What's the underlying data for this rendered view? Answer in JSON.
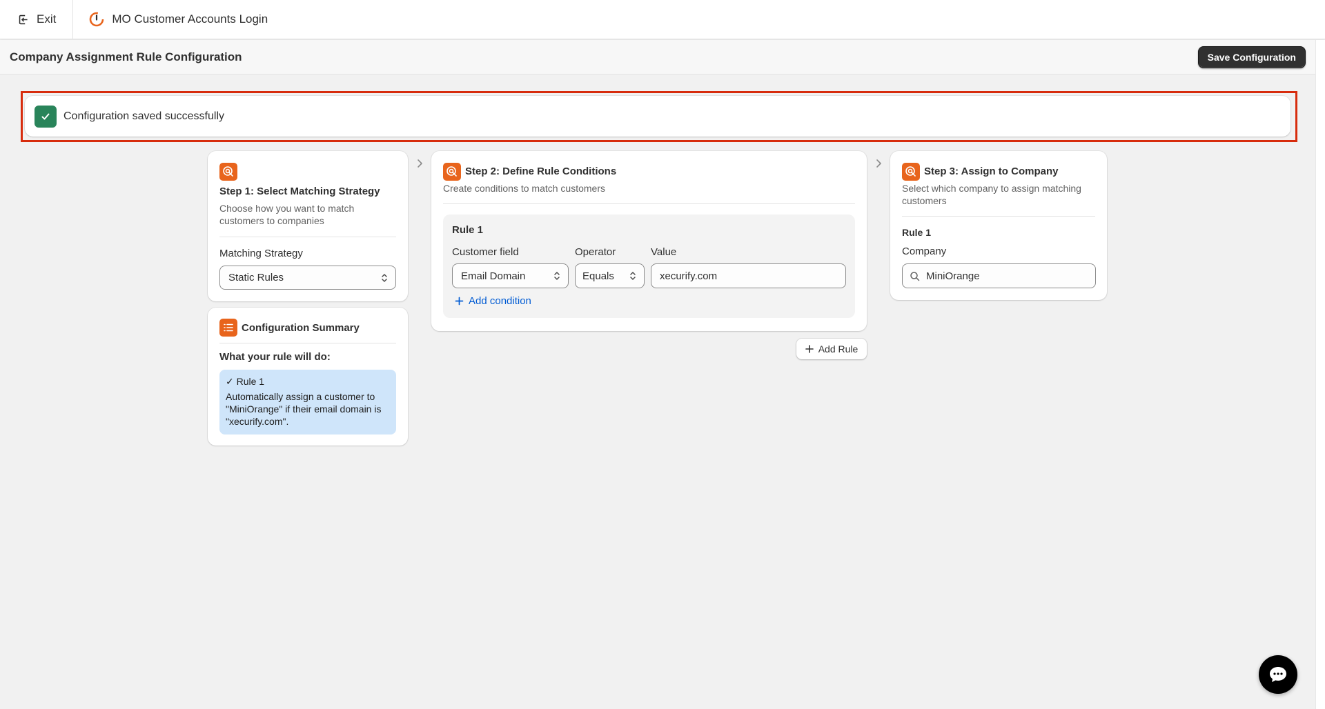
{
  "topbar": {
    "exit_label": "Exit",
    "app_title": "MO Customer Accounts Login"
  },
  "page": {
    "title": "Company Assignment Rule Configuration",
    "save_label": "Save Configuration"
  },
  "banner": {
    "message": "Configuration saved successfully",
    "color": "#29845a"
  },
  "step1": {
    "title": "Step 1: Select Matching Strategy",
    "subtitle": "Choose how you want to match customers to companies",
    "strategy_label": "Matching Strategy",
    "strategy_value": "Static Rules"
  },
  "summary": {
    "title": "Configuration Summary",
    "heading": "What your rule will do:",
    "rule_title": "✓ Rule 1",
    "rule_text": "Automatically assign a customer to \"MiniOrange\" if their email domain is \"xecurify.com\"."
  },
  "step2": {
    "title": "Step 2: Define Rule Conditions",
    "subtitle": "Create conditions to match customers",
    "rule_label": "Rule 1",
    "field_label": "Customer field",
    "field_value": "Email Domain",
    "operator_label": "Operator",
    "operator_value": "Equals",
    "value_label": "Value",
    "value_value": "xecurify.com",
    "add_condition_label": "Add condition",
    "add_rule_label": "Add Rule"
  },
  "step3": {
    "title": "Step 3: Assign to Company",
    "subtitle": "Select which company to assign matching customers",
    "rule_label": "Rule 1",
    "company_label": "Company",
    "company_value": "MiniOrange"
  },
  "colors": {
    "accent_orange": "#e8641c",
    "link_blue": "#005bd3",
    "highlight_outline": "#d72c0d",
    "summary_bg": "#cfe5fa"
  },
  "icons": {
    "exit": "exit-icon",
    "logo": "app-logo-icon",
    "check": "check-icon",
    "step": "target-cursor-icon",
    "summary": "list-icon",
    "chevron_right": "chevron-right-icon",
    "select": "select-chevrons-icon",
    "search": "search-icon",
    "plus": "plus-icon",
    "chat": "chat-icon"
  }
}
